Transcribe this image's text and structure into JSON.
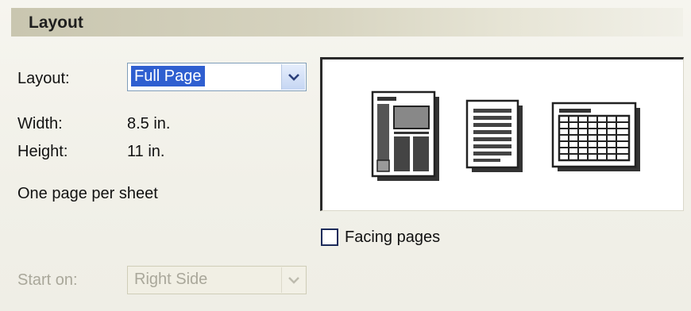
{
  "section": {
    "title": "Layout"
  },
  "layout_field": {
    "label": "Layout:",
    "selected": "Full Page"
  },
  "width": {
    "label": "Width:",
    "value": "8.5 in."
  },
  "height": {
    "label": "Height:",
    "value": "11 in."
  },
  "pages_per_sheet": "One page per sheet",
  "facing_pages": {
    "label": "Facing pages",
    "checked": false
  },
  "start_on": {
    "label": "Start on:",
    "selected": "Right Side",
    "disabled": true
  },
  "preview": {
    "thumbnails": [
      "newsletter-page-icon",
      "text-page-icon",
      "table-page-icon"
    ]
  },
  "colors": {
    "selection": "#2f5fd0",
    "field_border": "#7f9db9",
    "disabled_text": "#a9a79a"
  }
}
